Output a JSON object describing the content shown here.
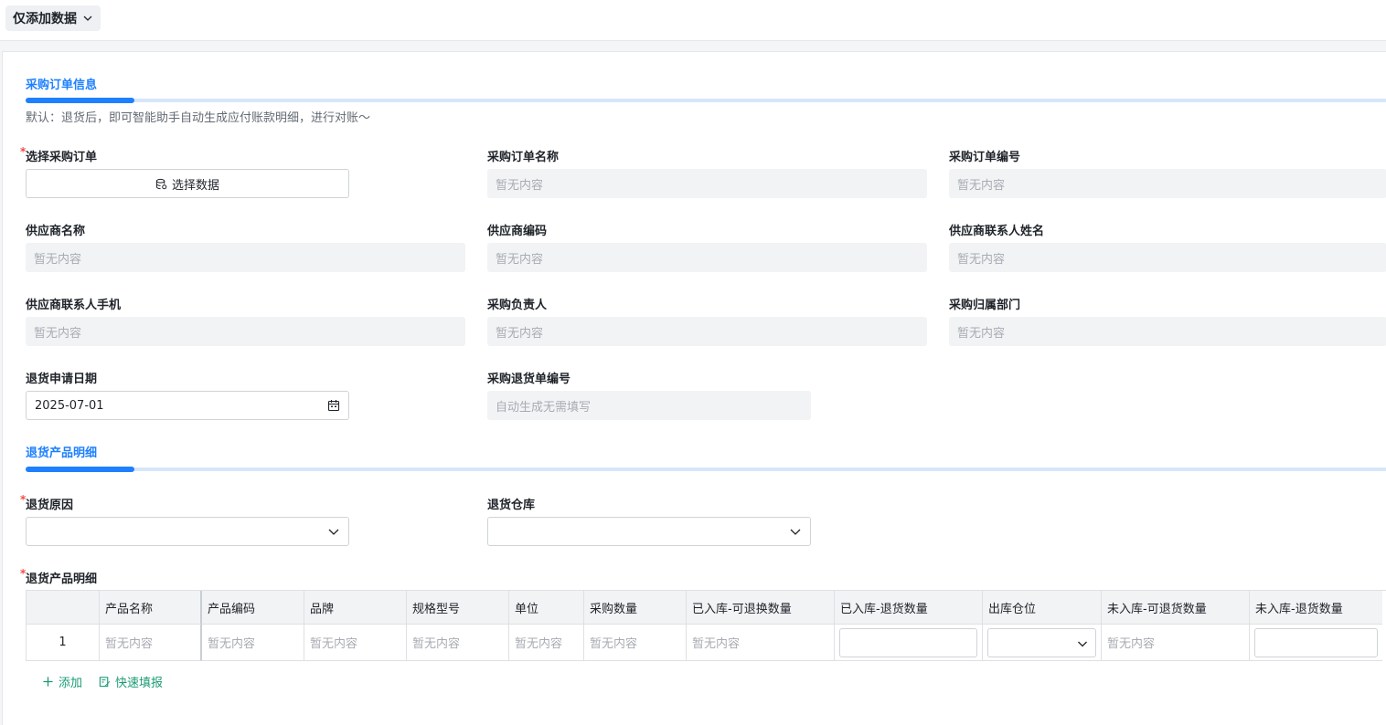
{
  "topbar": {
    "mode_label": "仅添加数据"
  },
  "sections": {
    "order_info": {
      "title": "采购订单信息",
      "hint": "默认：退货后，即可智能助手自动生成应付账款明细，进行对账〜"
    },
    "product_detail": {
      "title": "退货产品明细"
    }
  },
  "fields": {
    "select_order": {
      "label": "选择采购订单",
      "required": true,
      "button_label": "选择数据"
    },
    "order_name": {
      "label": "采购订单名称",
      "value": "暂无内容"
    },
    "order_no": {
      "label": "采购订单编号",
      "value": "暂无内容"
    },
    "supplier_name": {
      "label": "供应商名称",
      "value": "暂无内容"
    },
    "supplier_code": {
      "label": "供应商编码",
      "value": "暂无内容"
    },
    "supplier_contact_name": {
      "label": "供应商联系人姓名",
      "value": "暂无内容"
    },
    "supplier_contact_phone": {
      "label": "供应商联系人手机",
      "value": "暂无内容"
    },
    "purchase_owner": {
      "label": "采购负责人",
      "value": "暂无内容"
    },
    "purchase_dept": {
      "label": "采购归属部门",
      "value": "暂无内容"
    },
    "return_date": {
      "label": "退货申请日期",
      "value": "2025-07-01"
    },
    "return_no": {
      "label": "采购退货单编号",
      "value": "自动生成无需填写"
    },
    "return_reason": {
      "label": "退货原因",
      "required": true,
      "value": ""
    },
    "return_warehouse": {
      "label": "退货仓库",
      "value": ""
    },
    "return_items": {
      "label": "退货产品明细",
      "required": true
    }
  },
  "table": {
    "columns": [
      "",
      "产品名称",
      "产品编码",
      "品牌",
      "规格型号",
      "单位",
      "采购数量",
      "已入库-可退换数量",
      "已入库-退货数量",
      "出库仓位",
      "未入库-可退货数量",
      "未入库-退货数量"
    ],
    "rows": [
      {
        "index": "1",
        "product_name": "暂无内容",
        "product_code": "暂无内容",
        "brand": "暂无内容",
        "spec": "暂无内容",
        "unit": "暂无内容",
        "purchase_qty": "暂无内容",
        "stocked_returnable": "暂无内容",
        "stocked_return_qty": "",
        "out_location": "",
        "unstocked_returnable": "暂无内容",
        "unstocked_return_qty": ""
      }
    ]
  },
  "actions": {
    "add_label": "添加",
    "quick_fill_label": "快速填报"
  },
  "colors": {
    "accent": "#1e80ff",
    "action_green": "#1b9a74",
    "required": "#f54a45"
  }
}
